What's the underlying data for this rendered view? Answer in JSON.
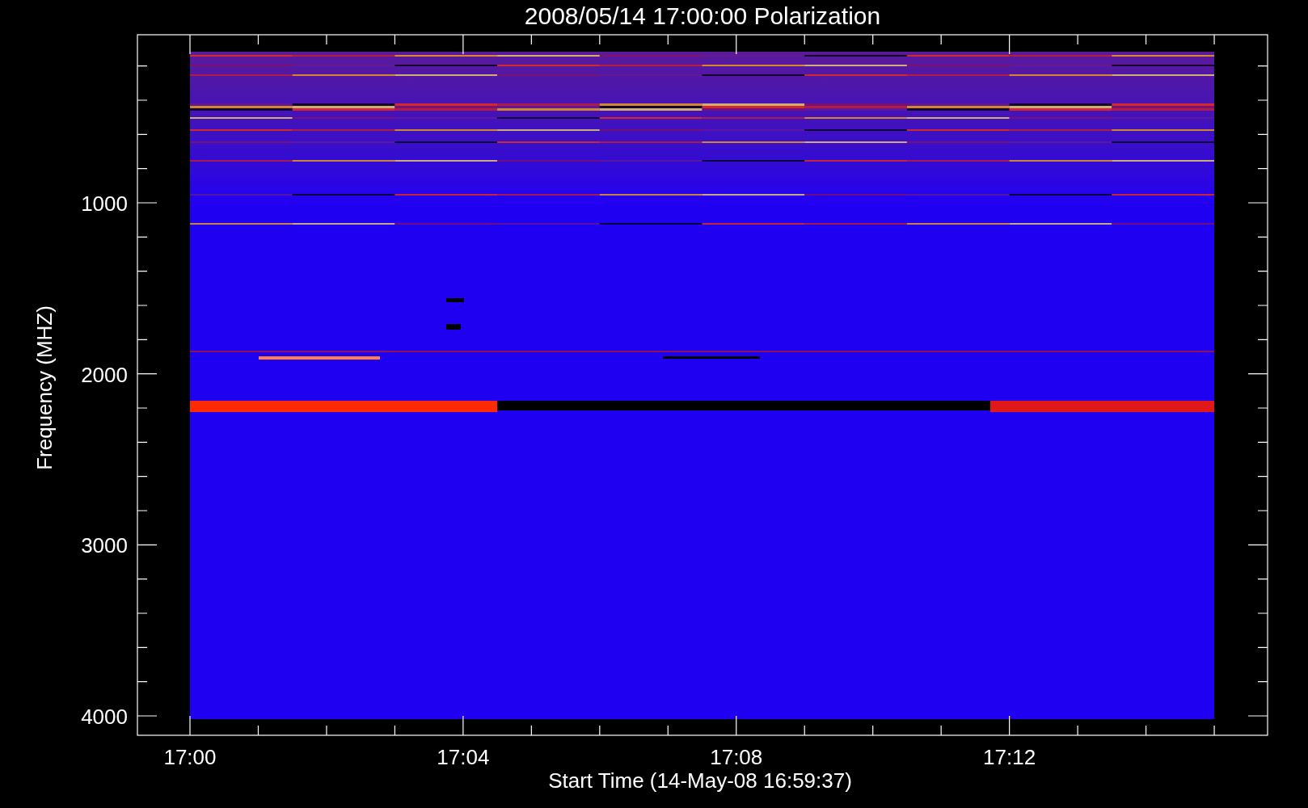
{
  "plot": {
    "title": "2008/05/14 17:00:00 Polarization",
    "xlabel": "Start Time (14-May-08 16:59:37)",
    "ylabel": "Frequency (MHZ)",
    "xticks": [
      "17:00",
      "17:04",
      "17:08",
      "17:12"
    ],
    "yticks": [
      "1000",
      "2000",
      "3000",
      "4000"
    ]
  }
}
